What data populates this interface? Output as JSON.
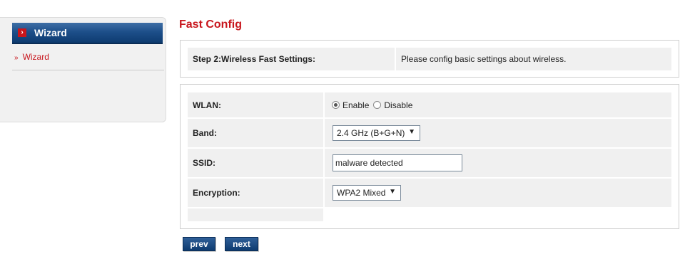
{
  "sidebar": {
    "header": "Wizard",
    "items": [
      {
        "label": "Wizard"
      }
    ]
  },
  "page_title": "Fast Config",
  "step": {
    "label": "Step 2:Wireless Fast Settings:",
    "description": "Please config basic settings about wireless."
  },
  "form": {
    "wlan": {
      "label": "WLAN:",
      "options": [
        "Enable",
        "Disable"
      ],
      "selected": "Enable"
    },
    "band": {
      "label": "Band:",
      "value": "2.4 GHz (B+G+N)"
    },
    "ssid": {
      "label": "SSID:",
      "value": "malware detected"
    },
    "encryption": {
      "label": "Encryption:",
      "value": "WPA2 Mixed"
    }
  },
  "buttons": {
    "prev": "prev",
    "next": "next"
  },
  "colors": {
    "accent": "#c8161d",
    "nav": "#0e3b70"
  }
}
